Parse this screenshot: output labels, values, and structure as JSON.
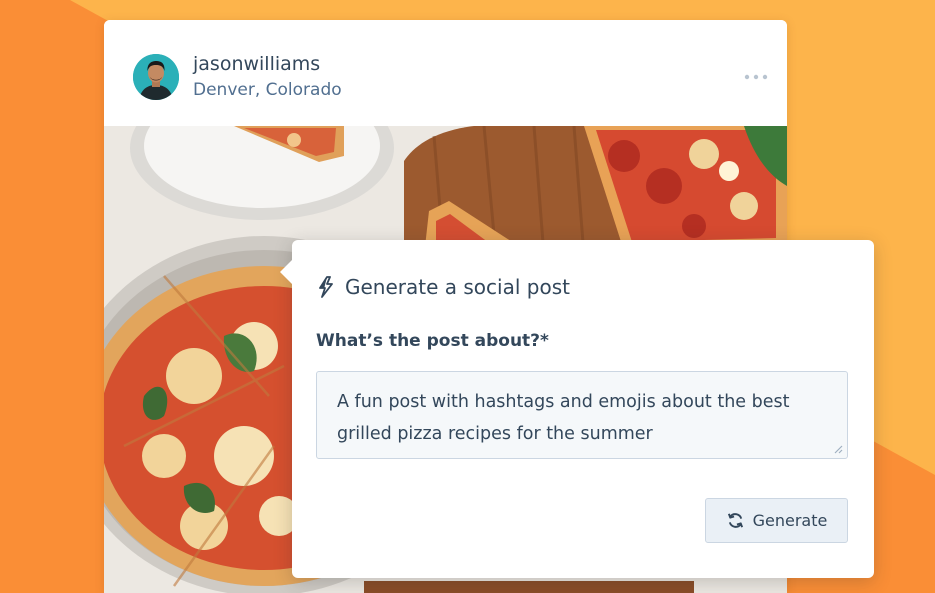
{
  "post": {
    "username": "jasonwilliams",
    "location": "Denver, Colorado",
    "avatar_color": "#2bb0b8",
    "menu_icon": "more-horizontal-icon"
  },
  "generator": {
    "title": "Generate a social post",
    "title_icon": "lightning-bolt-icon",
    "field_label": "What’s the post about?*",
    "field_value_line1": "A fun post with hashtags and emojis about the best",
    "field_value_line2": "grilled pizza recipes for the summer",
    "button_label": "Generate",
    "button_icon": "refresh-icon"
  },
  "colors": {
    "background_orange": "#fa8e36",
    "background_yellow": "#fdb44b",
    "text_primary": "#33475b"
  }
}
